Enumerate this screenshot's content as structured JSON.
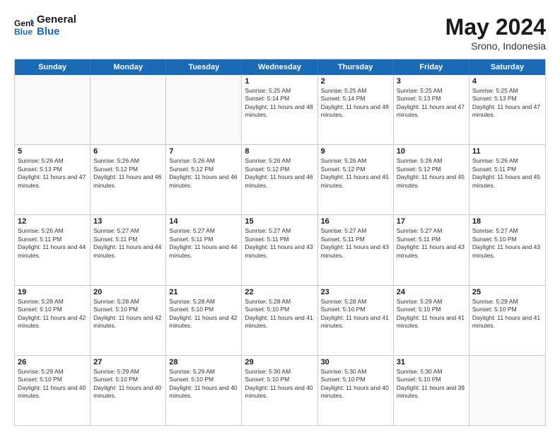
{
  "header": {
    "logo_line1": "General",
    "logo_line2": "Blue",
    "month_year": "May 2024",
    "location": "Srono, Indonesia"
  },
  "days_of_week": [
    "Sunday",
    "Monday",
    "Tuesday",
    "Wednesday",
    "Thursday",
    "Friday",
    "Saturday"
  ],
  "weeks": [
    [
      {
        "day": "",
        "sunrise": "",
        "sunset": "",
        "daylight": "",
        "empty": true
      },
      {
        "day": "",
        "sunrise": "",
        "sunset": "",
        "daylight": "",
        "empty": true
      },
      {
        "day": "",
        "sunrise": "",
        "sunset": "",
        "daylight": "",
        "empty": true
      },
      {
        "day": "1",
        "sunrise": "Sunrise: 5:25 AM",
        "sunset": "Sunset: 5:14 PM",
        "daylight": "Daylight: 11 hours and 48 minutes."
      },
      {
        "day": "2",
        "sunrise": "Sunrise: 5:25 AM",
        "sunset": "Sunset: 5:14 PM",
        "daylight": "Daylight: 11 hours and 48 minutes."
      },
      {
        "day": "3",
        "sunrise": "Sunrise: 5:25 AM",
        "sunset": "Sunset: 5:13 PM",
        "daylight": "Daylight: 11 hours and 47 minutes."
      },
      {
        "day": "4",
        "sunrise": "Sunrise: 5:25 AM",
        "sunset": "Sunset: 5:13 PM",
        "daylight": "Daylight: 11 hours and 47 minutes."
      }
    ],
    [
      {
        "day": "5",
        "sunrise": "Sunrise: 5:26 AM",
        "sunset": "Sunset: 5:13 PM",
        "daylight": "Daylight: 11 hours and 47 minutes."
      },
      {
        "day": "6",
        "sunrise": "Sunrise: 5:26 AM",
        "sunset": "Sunset: 5:12 PM",
        "daylight": "Daylight: 11 hours and 46 minutes."
      },
      {
        "day": "7",
        "sunrise": "Sunrise: 5:26 AM",
        "sunset": "Sunset: 5:12 PM",
        "daylight": "Daylight: 11 hours and 46 minutes."
      },
      {
        "day": "8",
        "sunrise": "Sunrise: 5:26 AM",
        "sunset": "Sunset: 5:12 PM",
        "daylight": "Daylight: 11 hours and 46 minutes."
      },
      {
        "day": "9",
        "sunrise": "Sunrise: 5:26 AM",
        "sunset": "Sunset: 5:12 PM",
        "daylight": "Daylight: 11 hours and 45 minutes."
      },
      {
        "day": "10",
        "sunrise": "Sunrise: 5:26 AM",
        "sunset": "Sunset: 5:12 PM",
        "daylight": "Daylight: 11 hours and 45 minutes."
      },
      {
        "day": "11",
        "sunrise": "Sunrise: 5:26 AM",
        "sunset": "Sunset: 5:11 PM",
        "daylight": "Daylight: 11 hours and 45 minutes."
      }
    ],
    [
      {
        "day": "12",
        "sunrise": "Sunrise: 5:26 AM",
        "sunset": "Sunset: 5:11 PM",
        "daylight": "Daylight: 11 hours and 44 minutes."
      },
      {
        "day": "13",
        "sunrise": "Sunrise: 5:27 AM",
        "sunset": "Sunset: 5:11 PM",
        "daylight": "Daylight: 11 hours and 44 minutes."
      },
      {
        "day": "14",
        "sunrise": "Sunrise: 5:27 AM",
        "sunset": "Sunset: 5:11 PM",
        "daylight": "Daylight: 11 hours and 44 minutes."
      },
      {
        "day": "15",
        "sunrise": "Sunrise: 5:27 AM",
        "sunset": "Sunset: 5:11 PM",
        "daylight": "Daylight: 11 hours and 43 minutes."
      },
      {
        "day": "16",
        "sunrise": "Sunrise: 5:27 AM",
        "sunset": "Sunset: 5:11 PM",
        "daylight": "Daylight: 11 hours and 43 minutes."
      },
      {
        "day": "17",
        "sunrise": "Sunrise: 5:27 AM",
        "sunset": "Sunset: 5:11 PM",
        "daylight": "Daylight: 11 hours and 43 minutes."
      },
      {
        "day": "18",
        "sunrise": "Sunrise: 5:27 AM",
        "sunset": "Sunset: 5:10 PM",
        "daylight": "Daylight: 11 hours and 43 minutes."
      }
    ],
    [
      {
        "day": "19",
        "sunrise": "Sunrise: 5:28 AM",
        "sunset": "Sunset: 5:10 PM",
        "daylight": "Daylight: 11 hours and 42 minutes."
      },
      {
        "day": "20",
        "sunrise": "Sunrise: 5:28 AM",
        "sunset": "Sunset: 5:10 PM",
        "daylight": "Daylight: 11 hours and 42 minutes."
      },
      {
        "day": "21",
        "sunrise": "Sunrise: 5:28 AM",
        "sunset": "Sunset: 5:10 PM",
        "daylight": "Daylight: 11 hours and 42 minutes."
      },
      {
        "day": "22",
        "sunrise": "Sunrise: 5:28 AM",
        "sunset": "Sunset: 5:10 PM",
        "daylight": "Daylight: 11 hours and 41 minutes."
      },
      {
        "day": "23",
        "sunrise": "Sunrise: 5:28 AM",
        "sunset": "Sunset: 5:10 PM",
        "daylight": "Daylight: 11 hours and 41 minutes."
      },
      {
        "day": "24",
        "sunrise": "Sunrise: 5:29 AM",
        "sunset": "Sunset: 5:10 PM",
        "daylight": "Daylight: 11 hours and 41 minutes."
      },
      {
        "day": "25",
        "sunrise": "Sunrise: 5:29 AM",
        "sunset": "Sunset: 5:10 PM",
        "daylight": "Daylight: 11 hours and 41 minutes."
      }
    ],
    [
      {
        "day": "26",
        "sunrise": "Sunrise: 5:29 AM",
        "sunset": "Sunset: 5:10 PM",
        "daylight": "Daylight: 11 hours and 40 minutes."
      },
      {
        "day": "27",
        "sunrise": "Sunrise: 5:29 AM",
        "sunset": "Sunset: 5:10 PM",
        "daylight": "Daylight: 11 hours and 40 minutes."
      },
      {
        "day": "28",
        "sunrise": "Sunrise: 5:29 AM",
        "sunset": "Sunset: 5:10 PM",
        "daylight": "Daylight: 11 hours and 40 minutes."
      },
      {
        "day": "29",
        "sunrise": "Sunrise: 5:30 AM",
        "sunset": "Sunset: 5:10 PM",
        "daylight": "Daylight: 11 hours and 40 minutes."
      },
      {
        "day": "30",
        "sunrise": "Sunrise: 5:30 AM",
        "sunset": "Sunset: 5:10 PM",
        "daylight": "Daylight: 11 hours and 40 minutes."
      },
      {
        "day": "31",
        "sunrise": "Sunrise: 5:30 AM",
        "sunset": "Sunset: 5:10 PM",
        "daylight": "Daylight: 11 hours and 39 minutes."
      },
      {
        "day": "",
        "sunrise": "",
        "sunset": "",
        "daylight": "",
        "empty": true
      }
    ]
  ]
}
